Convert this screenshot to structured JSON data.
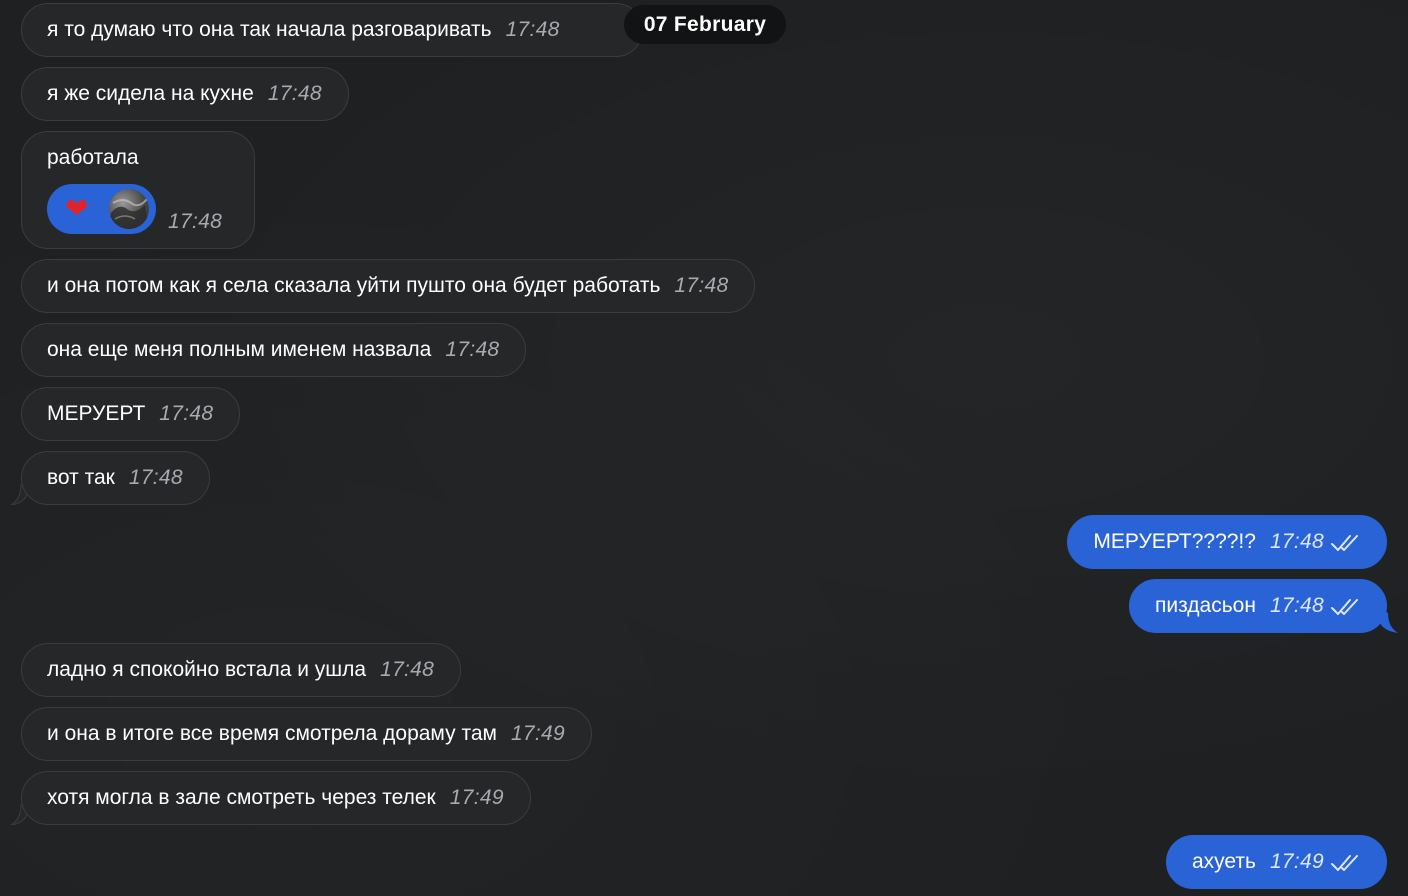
{
  "date_separator": "07 February",
  "messages": [
    {
      "text": "я то думаю что она так начала разговаривать",
      "time": "17:48"
    },
    {
      "text": "я же сидела на кухне",
      "time": "17:48"
    },
    {
      "text": "работала",
      "time": "17:48",
      "reaction": "heart"
    },
    {
      "text": "и она потом как я села сказала уйти пушто она будет работать",
      "time": "17:48"
    },
    {
      "text": "она еще меня полным именем назвала",
      "time": "17:48"
    },
    {
      "text": "МЕРУЕРТ",
      "time": "17:48"
    },
    {
      "text": "вот так",
      "time": "17:48"
    },
    {
      "text": "МЕРУЕРТ????!?",
      "time": "17:48",
      "read": true
    },
    {
      "text": "пиздасьон",
      "time": "17:48",
      "read": true
    },
    {
      "text": "ладно я спокойно встала и ушла",
      "time": "17:48"
    },
    {
      "text": "и она в итоге все время смотрела дораму там",
      "time": "17:49"
    },
    {
      "text": "хотя могла в зале смотреть через телек",
      "time": "17:49"
    },
    {
      "text": "ахуеть",
      "time": "17:49",
      "read": true
    }
  ],
  "colors": {
    "background": "#1e2022",
    "incoming_bubble": "#262729",
    "outgoing_bubble": "#2a63d6"
  }
}
